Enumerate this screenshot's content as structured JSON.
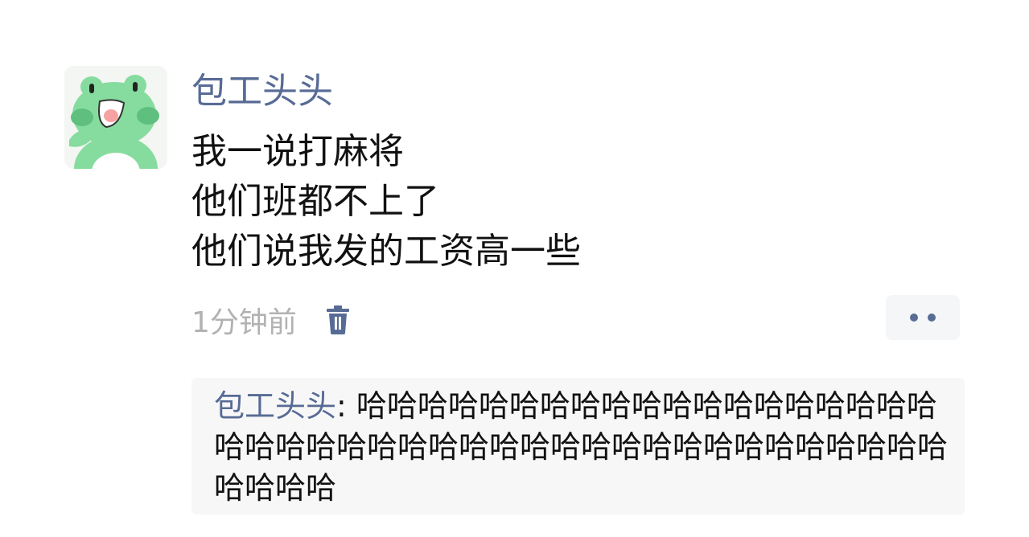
{
  "post": {
    "author": "包工头头",
    "avatar": "frog-avatar",
    "content_lines": [
      "我一说打麻将",
      "他们班都不上了",
      "他们说我发的工资高一些"
    ],
    "timestamp": "1分钟前",
    "delete_icon": "trash-icon",
    "more_icon": "more-dots-icon"
  },
  "comments": [
    {
      "author": "包工头头",
      "separator": ": ",
      "text": "哈哈哈哈哈哈哈哈哈哈哈哈哈哈哈哈哈哈哈哈哈哈哈哈哈哈哈哈哈哈哈哈哈哈哈哈哈哈哈哈哈哈哈哈哈哈哈"
    }
  ],
  "colors": {
    "link_blue": "#576b95",
    "text": "#111111",
    "muted": "#b2b2b2",
    "comment_bg": "#f7f7f7",
    "avatar_green": "#7ed99a"
  }
}
